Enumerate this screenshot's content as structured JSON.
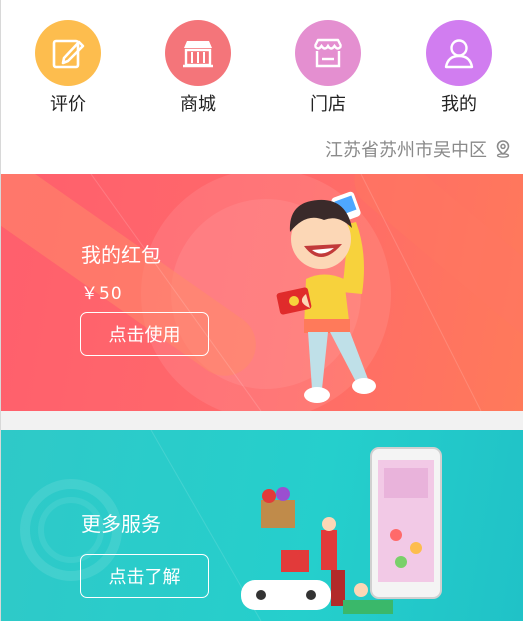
{
  "nav": {
    "items": [
      {
        "label": "评价",
        "icon": "edit-icon",
        "color": "#fdbd4e"
      },
      {
        "label": "商城",
        "icon": "shop-icon",
        "color": "#f4757a"
      },
      {
        "label": "门店",
        "icon": "store-icon",
        "color": "#e48fd0"
      },
      {
        "label": "我的",
        "icon": "user-icon",
        "color": "#d17df0"
      }
    ]
  },
  "location": {
    "text": "江苏省苏州市吴中区",
    "icon": "location-pin-icon"
  },
  "banners": [
    {
      "title": "我的红包",
      "subtitle": "￥50",
      "button": "点击使用",
      "color": "#ff6470"
    },
    {
      "title": "更多服务",
      "button": "点击了解",
      "color": "#29cbc9"
    }
  ]
}
